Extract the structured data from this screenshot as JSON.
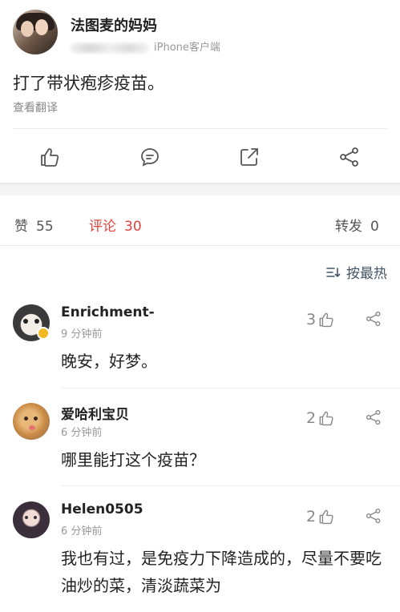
{
  "post": {
    "author": "法图麦的妈妈",
    "source": "iPhone客户端",
    "content": "打了带状疱疹疫苗。",
    "translate": "查看翻译"
  },
  "actions": {
    "icons": [
      "thumbs-up-icon",
      "comment-icon",
      "repost-icon",
      "share-icon"
    ]
  },
  "tabs": [
    {
      "label": "赞",
      "count": "55",
      "active": false
    },
    {
      "label": "评论",
      "count": "30",
      "active": true
    },
    {
      "label": "转发",
      "count": "0",
      "active": false
    }
  ],
  "sort": {
    "label": "按最热"
  },
  "comments": [
    {
      "name": "Enrichment-",
      "time": "9 分钟前",
      "text": "晚安，好梦。",
      "likes": "3"
    },
    {
      "name": "爱哈利宝贝",
      "time": "6 分钟前",
      "text": "哪里能打这个疫苗？",
      "likes": "2"
    },
    {
      "name": "Helen0505",
      "time": "6 分钟前",
      "text": "我也有过，是免疫力下降造成的，尽量不要吃油炒的菜，清淡蔬菜为",
      "likes": "2"
    }
  ],
  "colors": {
    "accent": "#e0443d",
    "muted": "#999999",
    "icon": "#555555"
  }
}
